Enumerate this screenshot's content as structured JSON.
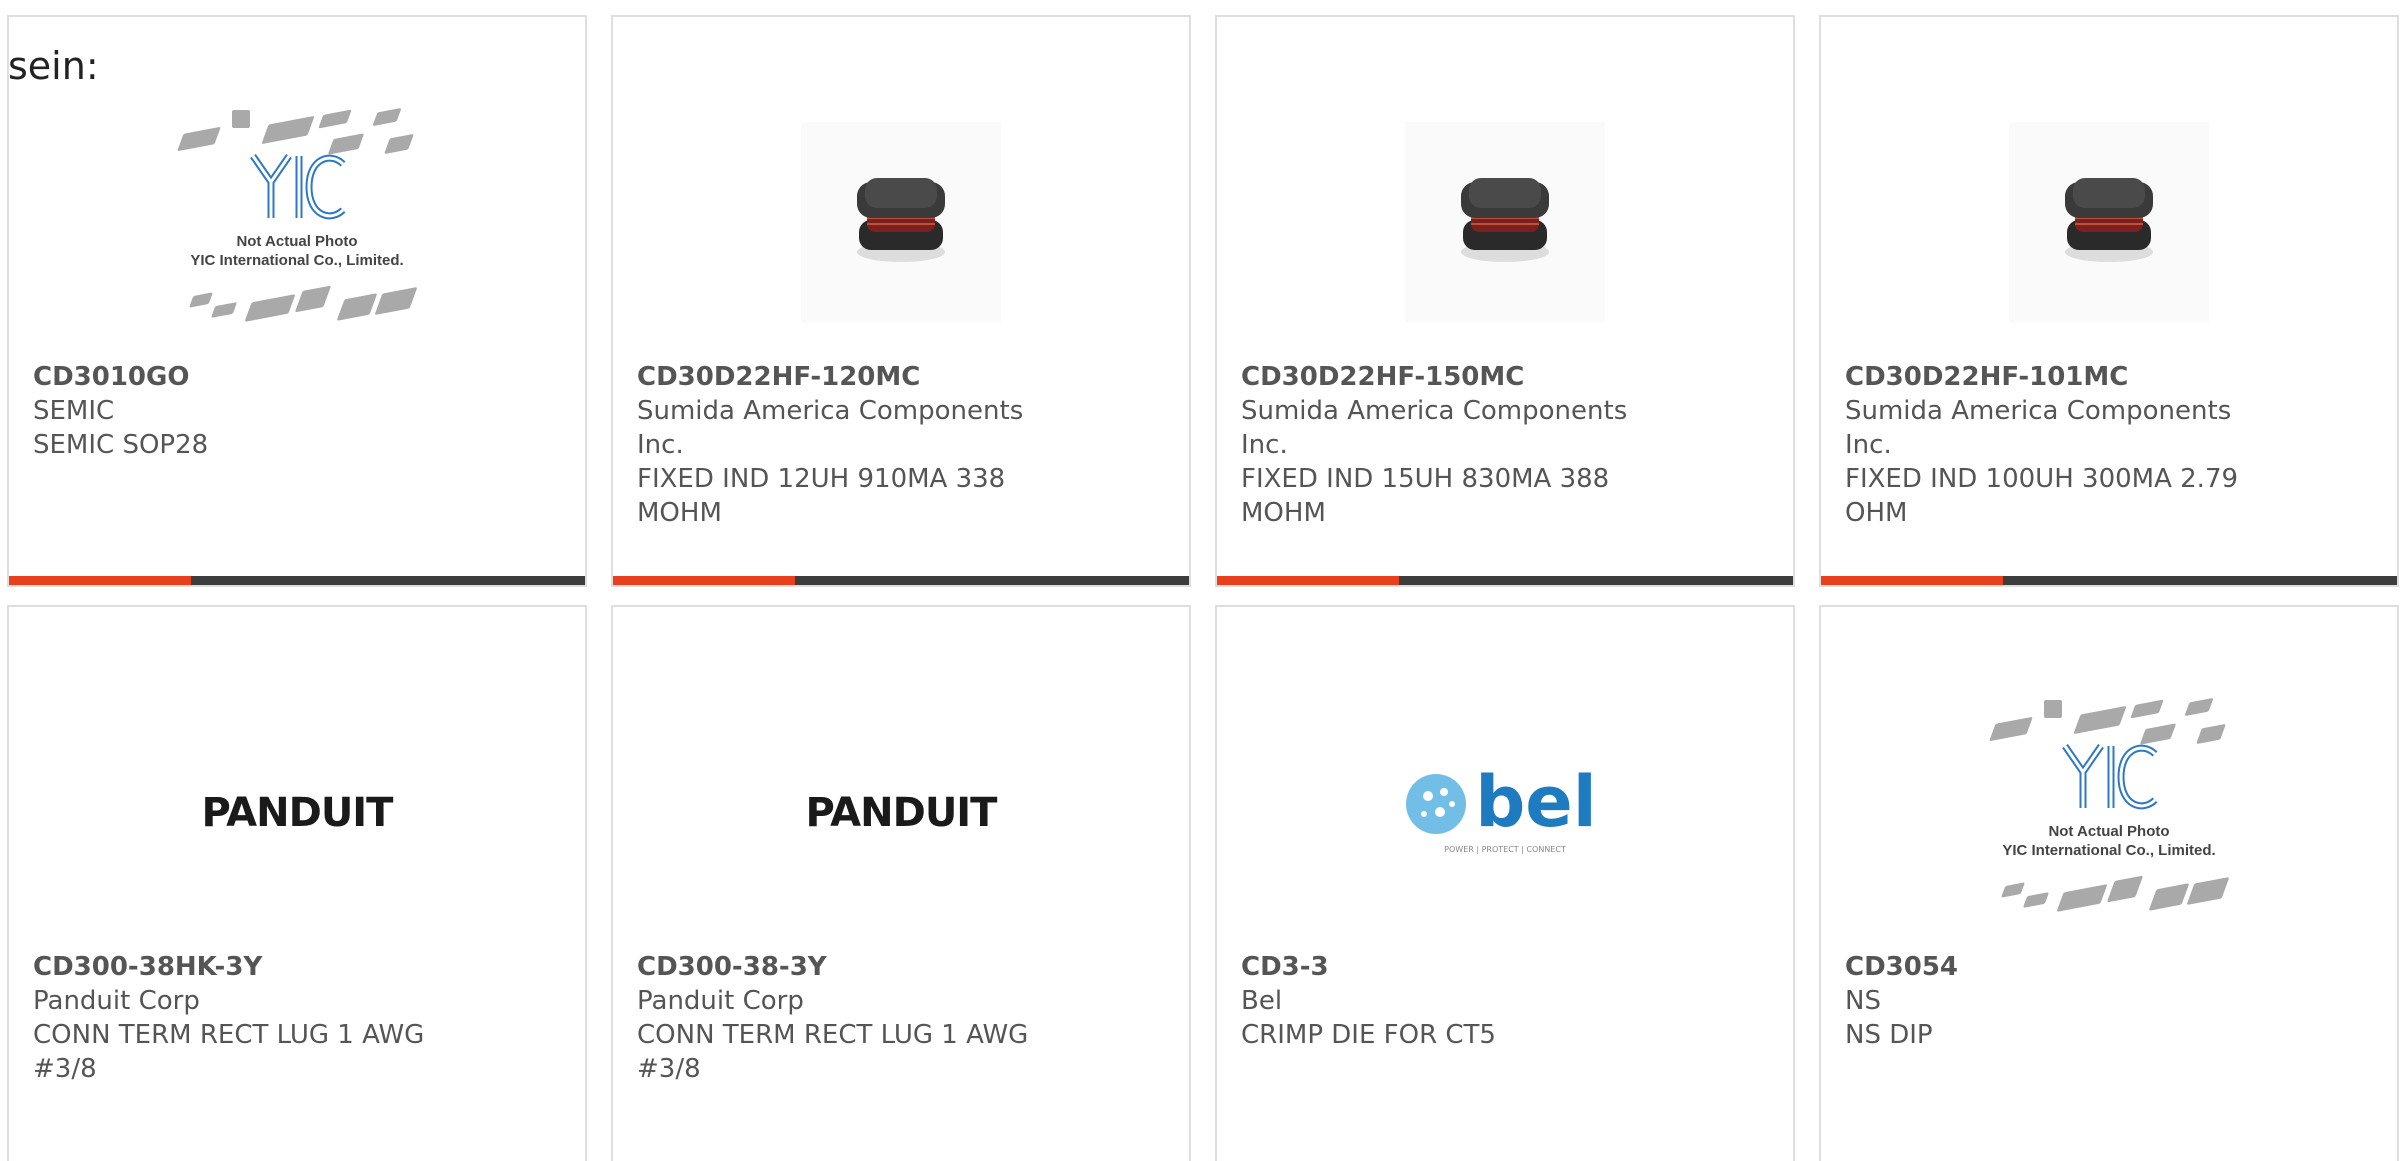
{
  "page": {
    "lead_text": "sein:"
  },
  "theme": {
    "accent_color": "#e8401c",
    "bar_color": "#3d3d3d",
    "border_color": "#dedede",
    "text_color": "#555555"
  },
  "placeholder": {
    "line1": "Not Actual Photo",
    "line2": "YIC International Co., Limited.",
    "logo": "YIC"
  },
  "products": [
    {
      "part_number": "CD3010GO",
      "manufacturer": "SEMIC",
      "description": "SEMIC SOP28",
      "image": "not-actual-photo"
    },
    {
      "part_number": "CD30D22HF-120MC",
      "manufacturer": "Sumida America Components Inc.",
      "description": "FIXED IND 12UH 910MA 338 MOHM",
      "image": "inductor-photo"
    },
    {
      "part_number": "CD30D22HF-150MC",
      "manufacturer": "Sumida America Components Inc.",
      "description": "FIXED IND 15UH 830MA 388 MOHM",
      "image": "inductor-photo"
    },
    {
      "part_number": "CD30D22HF-101MC",
      "manufacturer": "Sumida America Components Inc.",
      "description": "FIXED IND 100UH 300MA 2.79 OHM",
      "image": "inductor-photo"
    },
    {
      "part_number": "CD300-38HK-3Y",
      "manufacturer": "Panduit Corp",
      "description": "CONN TERM RECT LUG 1 AWG #3/8",
      "image": "panduit-logo",
      "logo_text": "PANDUIT"
    },
    {
      "part_number": "CD300-38-3Y",
      "manufacturer": "Panduit Corp",
      "description": "CONN TERM RECT LUG 1 AWG #3/8",
      "image": "panduit-logo",
      "logo_text": "PANDUIT"
    },
    {
      "part_number": "CD3-3",
      "manufacturer": "Bel",
      "description": "CRIMP DIE FOR CT5",
      "image": "bel-logo",
      "logo_text": "bel",
      "logo_tagline": "POWER | PROTECT | CONNECT"
    },
    {
      "part_number": "CD3054",
      "manufacturer": "NS",
      "description": "NS DIP",
      "image": "not-actual-photo"
    }
  ]
}
